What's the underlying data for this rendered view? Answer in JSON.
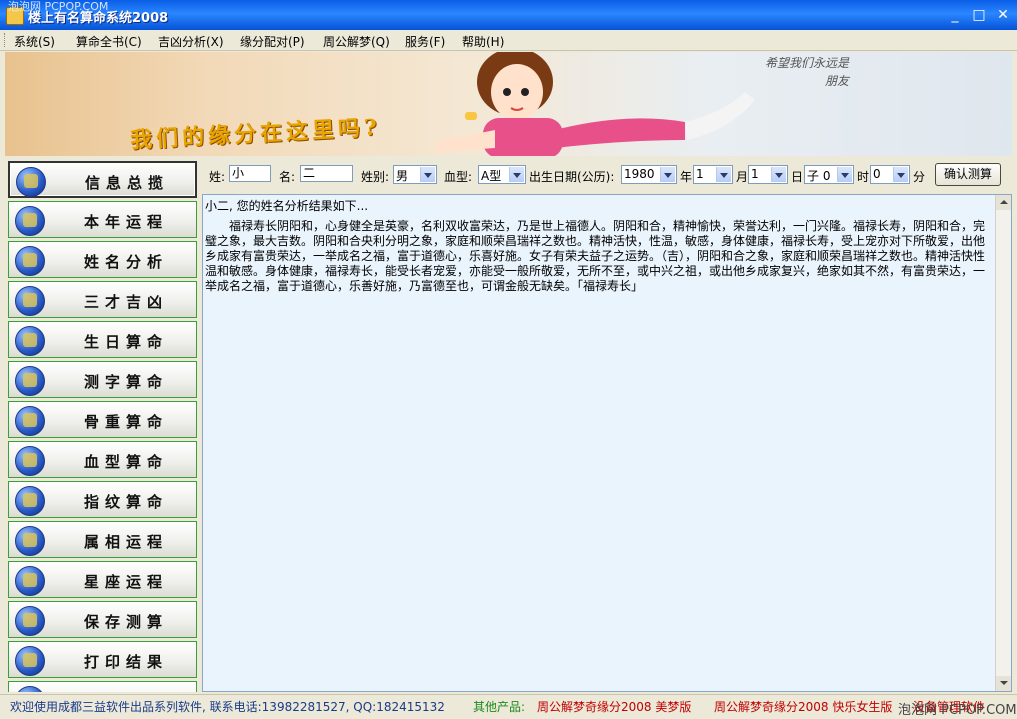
{
  "window": {
    "title": "楼上有名算命系统2008",
    "watermark": "泡泡网 PCPOP.COM"
  },
  "menu": [
    "系统(S)",
    "算命全书(C)",
    "吉凶分析(X)",
    "缘分配对(P)",
    "周公解梦(Q)",
    "服务(F)",
    "帮助(H)"
  ],
  "banner": {
    "slogan": "我们的缘分在这里吗?",
    "right_line1": "希望我们永远是",
    "right_line2": "朋友"
  },
  "sidebar": {
    "items": [
      "信息总揽",
      "本年运程",
      "姓名分析",
      "三才吉凶",
      "生日算命",
      "测字算命",
      "骨重算命",
      "血型算命",
      "指纹算命",
      "属相运程",
      "星座运程",
      "保存测算",
      "打印结果"
    ]
  },
  "form": {
    "surname_label": "姓:",
    "surname_value": "小",
    "name_label": "名:",
    "name_value": "二",
    "gender_label": "姓别:",
    "gender_value": "男",
    "blood_label": "血型:",
    "blood_value": "A型",
    "birth_label": "出生日期(公历):",
    "year_value": "1980",
    "year_unit": "年",
    "month_value": "1",
    "month_unit": "月",
    "day_value": "1",
    "day_unit": "日",
    "hour_value": "子 0",
    "hour_unit": "时",
    "minute_value": "0",
    "minute_unit": "分",
    "confirm_label": "确认测算"
  },
  "result": {
    "heading": "小二, 您的姓名分析结果如下...",
    "text": "福禄寿长阴阳和，心身健全是英豪，名利双收富荣达，乃是世上福德人。阴阳和合，精神愉快，荣誉达利，一门兴隆。福禄长寿，阴阳和合，完璧之象，最大吉数。阴阳和合央利分明之象，家庭和顺荣昌瑞祥之数也。精神活快，性温，敏感，身体健康，福禄长寿，受上宠亦对下所敬爱，出他乡成家有富贵荣达，一举成名之福，富于道德心，乐喜好施。女子有荣夫益子之运势。（吉），阴阳和合之象，家庭和顺荣昌瑞祥之数也。精神活快性温和敏感。身体健康，福禄寿长，能受长者宠爱，亦能受一般所敬爱，无所不至，或中兴之祖，或出他乡成家复兴，绝家如其不然，有富贵荣达，一举成名之福，富于道德心，乐善好施，乃富德至也，可谓金般无缺矣。「福禄寿长」"
  },
  "status": {
    "welcome": "欢迎使用成都三益软件出品系列软件, 联系电话:13982281527, QQ:182415132",
    "other_label": "其他产品:",
    "product1": "周公解梦奇缘分2008 美梦版",
    "product2": "周公解梦奇缘分2008 快乐女生版",
    "more": "没备管理软件",
    "watermark": "泡泡网 PCPOP.COM"
  }
}
